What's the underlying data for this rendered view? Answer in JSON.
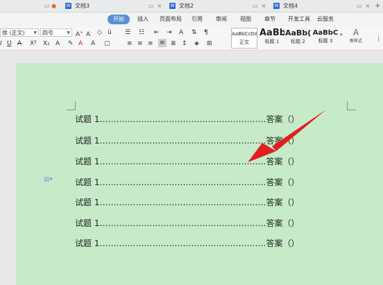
{
  "tabs": [
    {
      "title": "文档3"
    },
    {
      "title": "文档2"
    },
    {
      "title": "文档4"
    }
  ],
  "menu": [
    {
      "label": "开始"
    },
    {
      "label": "插入"
    },
    {
      "label": "页面布局"
    },
    {
      "label": "引用"
    },
    {
      "label": "审阅"
    },
    {
      "label": "视图"
    },
    {
      "label": "章节"
    },
    {
      "label": "开发工具"
    },
    {
      "label": "云服务"
    }
  ],
  "font": {
    "name": "体 (正文)",
    "size": "四号"
  },
  "styles": [
    {
      "sample": "AaBbCcDd",
      "caption": "正文"
    },
    {
      "sample": "AaBb",
      "caption": "标题 1"
    },
    {
      "sample": "AaBb(",
      "caption": "标题 2"
    },
    {
      "sample": "AaBbC",
      "caption": "标题 3"
    }
  ],
  "new_style": "新样式",
  "document": {
    "lines": [
      "试题 1……………………………………………………答案（）",
      "试题 1……………………………………………………答案（）",
      "试题 1……………………………………………………答案（）",
      "试题 1……………………………………………………答案（）",
      "试题 1……………………………………………………答案（）",
      "试题 1……………………………………………………答案（）",
      "试题 1……………………………………………………答案（）"
    ]
  },
  "colors": {
    "page_bg": "#c7ebc9",
    "active_tab": "#5b8ed8",
    "arrow": "#e02020"
  }
}
